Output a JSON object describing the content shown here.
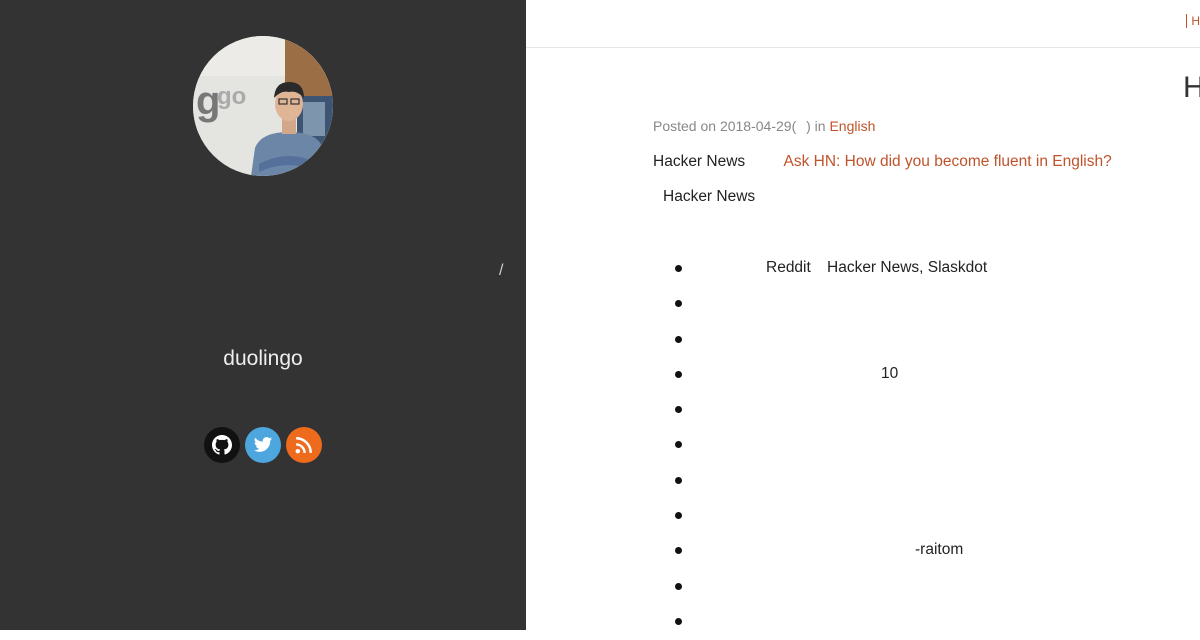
{
  "sidebar": {
    "avatar_alt": "profile photo",
    "avatar_sign": "go",
    "slash": "/",
    "name": "duolingo",
    "social": [
      "github-icon",
      "twitter-icon",
      "rss-icon"
    ],
    "colors": {
      "background": "#333333",
      "github": "#111111",
      "twitter": "#4da7de",
      "rss": "#ee6a1d"
    }
  },
  "topbar": {
    "link": "H"
  },
  "post": {
    "title_fragment": "H",
    "meta": {
      "prefix": "Posted on",
      "date": "2018-04-29(",
      "suffix": ") in",
      "category": "English"
    },
    "para1": {
      "text": "Hacker News",
      "link": "Ask HN: How did you become fluent in English?"
    },
    "para2": "Hacker News",
    "list": [
      {
        "parts": [
          "Reddit",
          "Hacker News, Slaskdot"
        ]
      },
      {
        "parts": []
      },
      {
        "parts": []
      },
      {
        "parts": [
          "10"
        ]
      },
      {
        "parts": []
      },
      {
        "parts": []
      },
      {
        "parts": []
      },
      {
        "parts": []
      },
      {
        "parts": [
          "-raitom"
        ]
      },
      {
        "parts": []
      },
      {
        "parts": []
      }
    ],
    "accent": "#c0532b"
  }
}
